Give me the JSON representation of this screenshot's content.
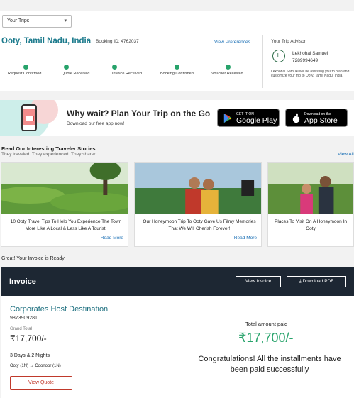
{
  "trip": {
    "select_label": "Your Trips",
    "destination": "Ooty, Tamil Nadu, India",
    "booking_label": "Booking ID: 4762037",
    "view_preferences": "View Preferences",
    "steps": [
      "Request Confirmed",
      "Quote Received",
      "Invoice Received",
      "Booking Confirmed",
      "Voucher Received"
    ]
  },
  "advisor": {
    "title": "Your Trip Advisor",
    "initial": "L",
    "name": "Lekhohal Samuel",
    "phone": "7289994649",
    "note": "Lekhohal Samuel will be assisting you to plan and customize your trip to Ooty, Tamil Nadu, India"
  },
  "banner": {
    "title": "Why wait? Plan Your Trip on the Go",
    "subtitle": "Download our free app now!",
    "google_small": "GET IT ON",
    "google_big": "Google Play",
    "apple_small": "Download on the",
    "apple_big": "App Store"
  },
  "stories": {
    "title": "Read Our Interesting Traveler Stories",
    "subtitle": "They traveled. They experienced. They shared.",
    "view_all": "View All",
    "read_more": "Read More",
    "items": [
      {
        "text": "10 Ooty Travel Tips To Help You Experience The Town More Like A Local & Less Like A Tourist!"
      },
      {
        "text": "Our Honeymoon Trip To Ooty Gave Us Filmy Memories That We Will Cherish Forever!"
      },
      {
        "text": "Places To Visit On A Honeymoon In Ooty"
      }
    ]
  },
  "invoice": {
    "ready_text": "Great! Your Invoice is Ready",
    "title": "Invoice",
    "view_invoice": "View Invoice",
    "download_pdf": "Download PDF",
    "company": "Corporates Host Destination",
    "phone": "9873909281",
    "grand_total_label": "Grand Total",
    "grand_total": "₹17,700/-",
    "duration": "3 Days & 2 Nights",
    "route": "Ooty (1N) → Coonoor (1N)",
    "view_quote": "View Quote",
    "total_paid_label": "Total amount paid",
    "total_paid": "₹17,700/-",
    "congrats": "Congratulations! All the installments have been paid successfully"
  },
  "colors": {
    "accent_teal": "#1b7a8c",
    "status_green": "#27a36b",
    "link_blue": "#1a6fb5",
    "invoice_header": "#1d2733",
    "quote_red": "#c0392b"
  }
}
